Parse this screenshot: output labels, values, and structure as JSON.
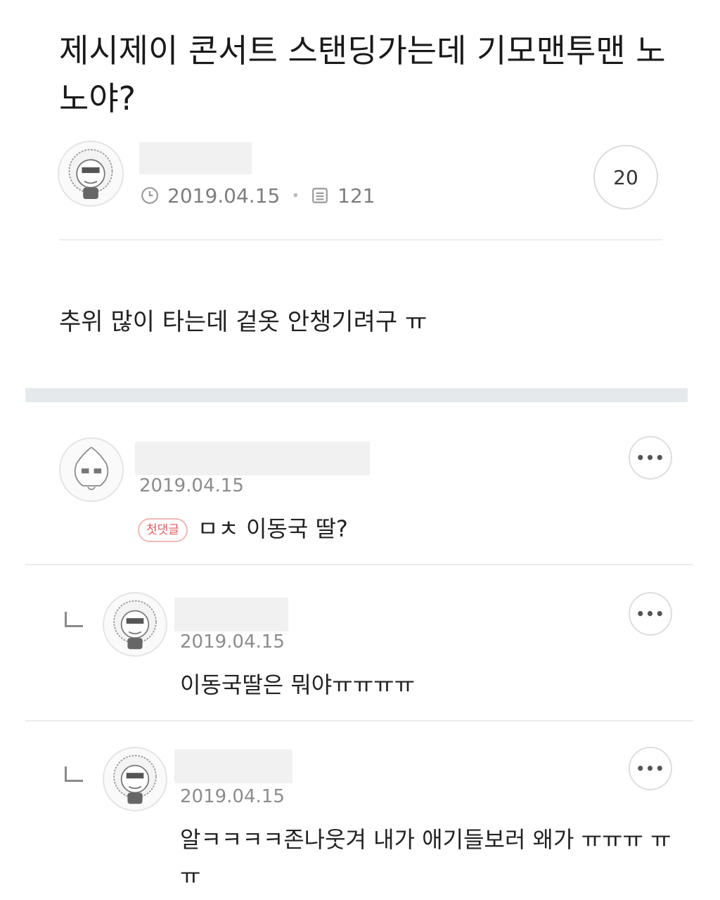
{
  "post": {
    "title": "제시제이 콘서트 스탠딩가는데 기모맨투맨 노노야?",
    "date": "2019.04.15",
    "views": "121",
    "comment_count": "20",
    "body": "추위 많이 타는데 겉옷 안챙기려구 ㅠ"
  },
  "icons": {
    "clock": "clock-icon",
    "views": "document-icon",
    "more": "more-icon",
    "reply": "reply-arrow-icon"
  },
  "comments": [
    {
      "date": "2019.04.15",
      "badge": "첫댓글",
      "text": "ㅁㅊ 이동국 딸?",
      "more": "•••"
    },
    {
      "date": "2019.04.15",
      "text": "이동국딸은 뭐야ㅠㅠㅠㅠ",
      "more": "•••"
    },
    {
      "date": "2019.04.15",
      "text": "알ㅋㅋㅋㅋ존나웃겨 내가 애기들보러 왜가 ㅠㅠㅠ ㅠㅠ",
      "more": "•••"
    }
  ],
  "colors": {
    "badge": "#e65a5a",
    "divider": "#ececec",
    "section_bar": "#e6e9ec",
    "meta_text": "#7d7d7d"
  }
}
